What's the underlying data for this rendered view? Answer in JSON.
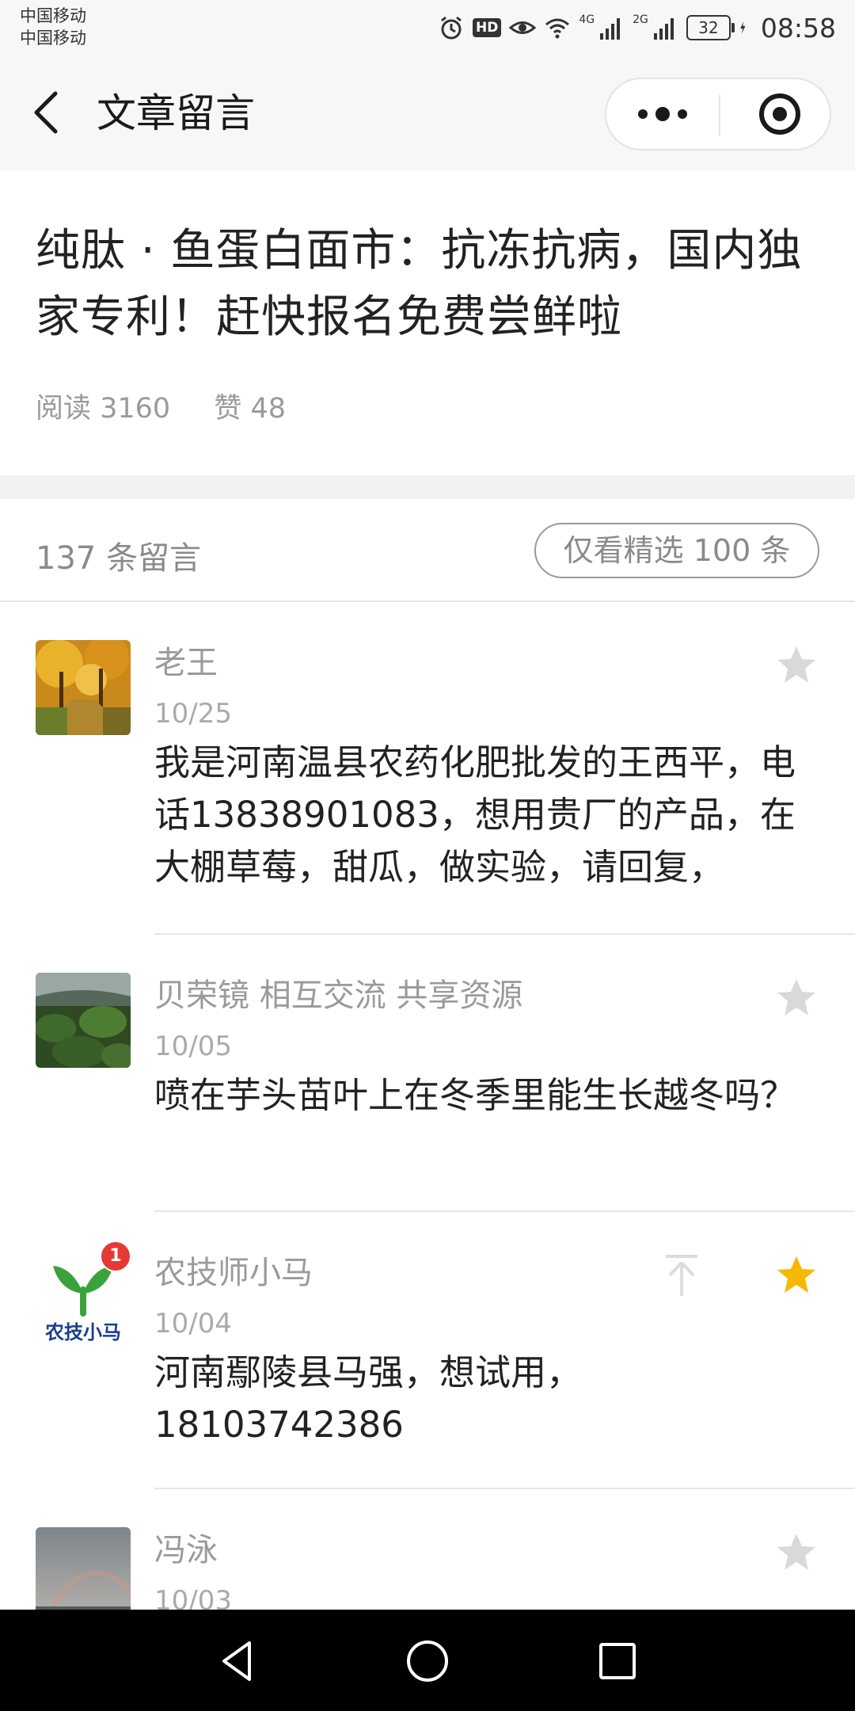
{
  "status_bar": {
    "carrier_1": "中国移动",
    "carrier_2": "中国移动",
    "hd_label": "HD",
    "net_1": "4G",
    "net_2": "2G",
    "battery": "32",
    "time": "08:58",
    "icons": [
      "alarm-icon",
      "hd-icon",
      "eye-icon",
      "wifi-icon",
      "signal-icon",
      "signal-icon",
      "battery-icon",
      "charging-icon"
    ]
  },
  "nav": {
    "title": "文章留言",
    "icons": [
      "back-chevron-icon",
      "more-dots-icon",
      "close-target-icon"
    ]
  },
  "article": {
    "title": "纯肽 · 鱼蛋白面市：抗冻抗病，国内独家专利！赶快报名免费尝鲜啦",
    "reads": "阅读 3160",
    "likes": "赞 48"
  },
  "comments_header": {
    "count_text": "137 条留言",
    "filter_label": "仅看精选 100 条"
  },
  "comments": [
    {
      "name": "老王",
      "date": "10/25",
      "text": "我是河南温县农药化肥批发的王西平，电话13838901083，想用贵厂的产品，在大棚草莓，甜瓜，做实验，请回复，",
      "starred": false
    },
    {
      "name": "贝荣镜 相互交流 共享资源",
      "date": "10/05",
      "text": "喷在芋头苗叶上在冬季里能生长越冬吗？",
      "starred": false
    },
    {
      "name": "农技师小马",
      "date": "10/04",
      "text": "河南鄢陵县马强，想试用，18103742386",
      "starred": true,
      "avatar_text": "农技小马",
      "badge": "1"
    },
    {
      "name": "冯泳",
      "date": "10/03",
      "text": "",
      "starred": false
    }
  ],
  "colors": {
    "star_active": "#f5b800",
    "star_inactive": "#d9d9d9",
    "badge_red": "#e53935",
    "meta_gray": "#9a9a9a"
  }
}
